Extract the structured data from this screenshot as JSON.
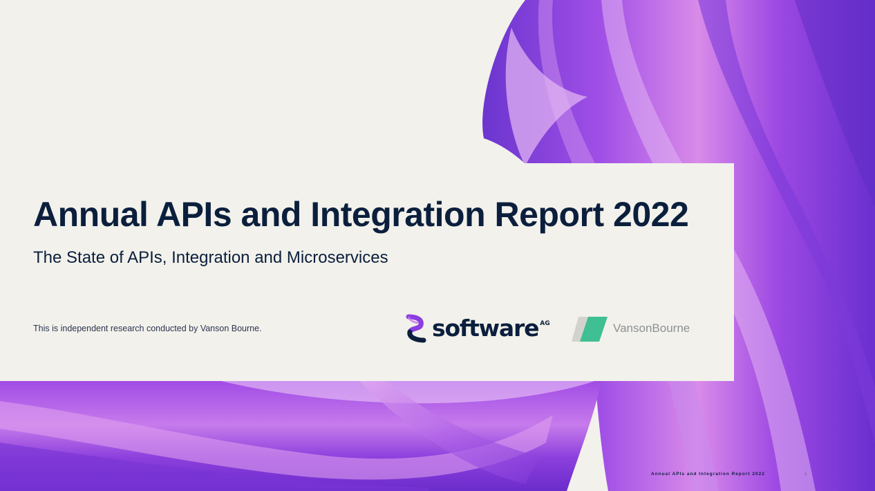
{
  "report": {
    "title": "Annual APIs and Integration Report 2022",
    "subtitle": "The State of APIs, Integration and Microservices",
    "note": "This is independent research conducted by Vanson Bourne."
  },
  "logos": {
    "software_ag": {
      "word": "software",
      "suffix": "AG",
      "icon": "software-ag-s-icon"
    },
    "vanson_bourne": {
      "word_first": "Vanson",
      "word_second": "Bourne",
      "icon": "vanson-bourne-mark-icon"
    }
  },
  "footer": {
    "title": "Annual APIs and Integration Report 2022",
    "page_number": "1"
  },
  "colors": {
    "background": "#f2f1eb",
    "title_text": "#0b1f3d",
    "ribbon_purple": "#9b45e0",
    "ribbon_violet": "#7a3fd6",
    "ribbon_pink": "#d77ce8",
    "vb_green": "#3fbf93",
    "vb_grey": "#c9c9c4"
  }
}
